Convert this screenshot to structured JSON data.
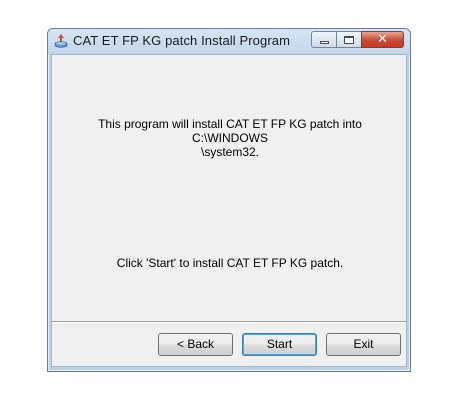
{
  "window": {
    "title": "CAT ET FP KG patch Install Program",
    "caption_buttons": {
      "minimize_icon": "minimize-icon",
      "maximize_icon": "maximize-icon",
      "close_glyph": "✕"
    }
  },
  "content": {
    "message_line1": "This program will install CAT ET FP KG patch into C:\\WINDOWS",
    "message_line2": "\\system32.",
    "instruction": "Click 'Start' to install CAT ET FP KG patch."
  },
  "buttons": {
    "back_label": "< Back",
    "start_label": "Start",
    "exit_label": "Exit"
  },
  "colors": {
    "client_background": "#f0f0f0",
    "close_button": "#c74a33",
    "titlebar": "#c2d6ec"
  }
}
